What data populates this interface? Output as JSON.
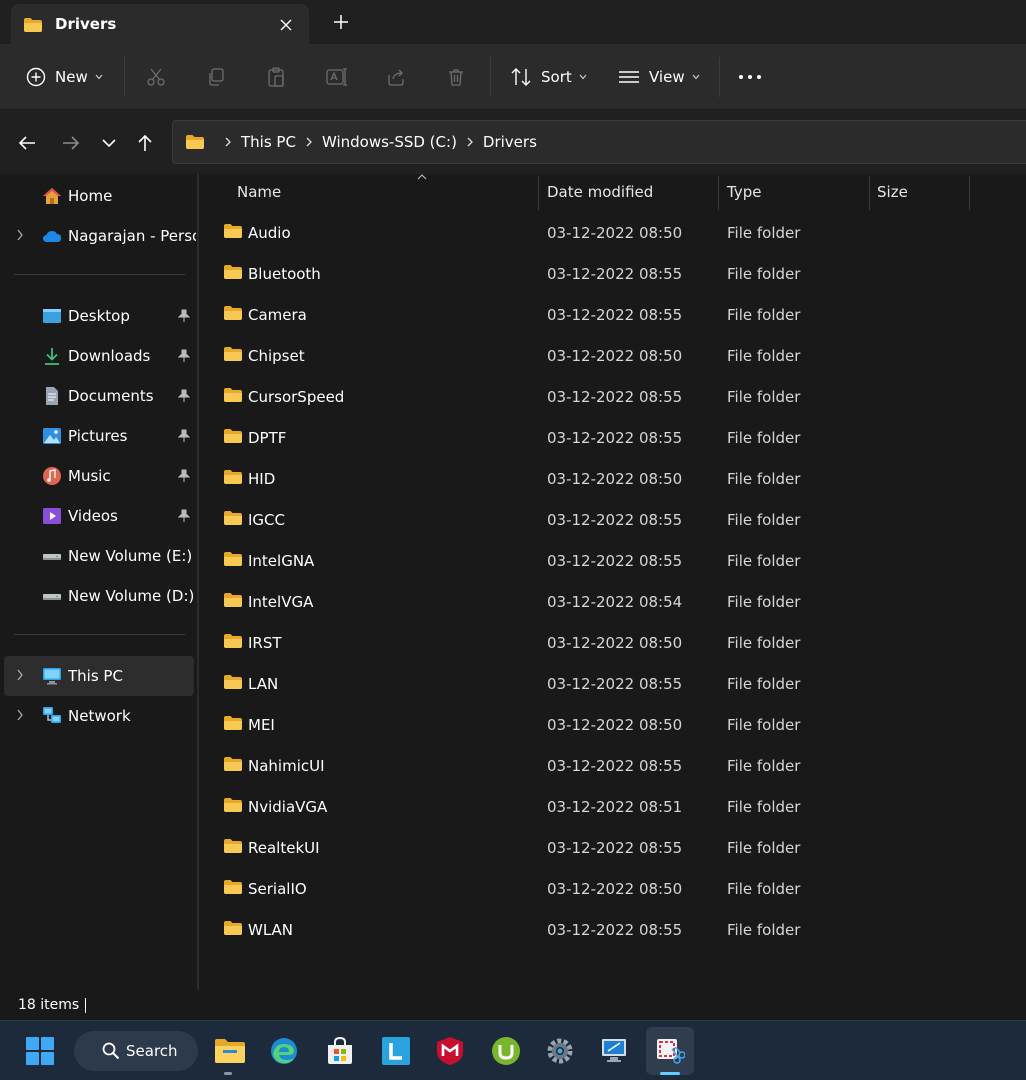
{
  "tab": {
    "title": "Drivers"
  },
  "toolbar": {
    "new_label": "New",
    "sort_label": "Sort",
    "view_label": "View"
  },
  "address": {
    "crumbs": [
      "This PC",
      "Windows-SSD (C:)",
      "Drivers"
    ]
  },
  "sidebar": {
    "top": [
      {
        "label": "Home",
        "icon": "home-icon"
      },
      {
        "label": "Nagarajan - Person",
        "icon": "onedrive-cloud-icon"
      }
    ],
    "quick": [
      {
        "label": "Desktop",
        "icon": "desktop-icon"
      },
      {
        "label": "Downloads",
        "icon": "download-icon"
      },
      {
        "label": "Documents",
        "icon": "document-icon"
      },
      {
        "label": "Pictures",
        "icon": "pictures-icon"
      },
      {
        "label": "Music",
        "icon": "music-icon"
      },
      {
        "label": "Videos",
        "icon": "videos-icon"
      },
      {
        "label": "New Volume (E:)",
        "icon": "drive-icon"
      },
      {
        "label": "New Volume (D:)",
        "icon": "drive-icon"
      }
    ],
    "bottom": [
      {
        "label": "This PC",
        "icon": "pc-icon"
      },
      {
        "label": "Network",
        "icon": "network-icon"
      }
    ]
  },
  "columns": {
    "name": "Name",
    "date": "Date modified",
    "type": "Type",
    "size": "Size"
  },
  "files": [
    {
      "name": "Audio",
      "date": "03-12-2022 08:50",
      "type": "File folder"
    },
    {
      "name": "Bluetooth",
      "date": "03-12-2022 08:55",
      "type": "File folder"
    },
    {
      "name": "Camera",
      "date": "03-12-2022 08:55",
      "type": "File folder"
    },
    {
      "name": "Chipset",
      "date": "03-12-2022 08:50",
      "type": "File folder"
    },
    {
      "name": "CursorSpeed",
      "date": "03-12-2022 08:55",
      "type": "File folder"
    },
    {
      "name": "DPTF",
      "date": "03-12-2022 08:55",
      "type": "File folder"
    },
    {
      "name": "HID",
      "date": "03-12-2022 08:50",
      "type": "File folder"
    },
    {
      "name": "IGCC",
      "date": "03-12-2022 08:55",
      "type": "File folder"
    },
    {
      "name": "IntelGNA",
      "date": "03-12-2022 08:55",
      "type": "File folder"
    },
    {
      "name": "IntelVGA",
      "date": "03-12-2022 08:54",
      "type": "File folder"
    },
    {
      "name": "IRST",
      "date": "03-12-2022 08:50",
      "type": "File folder"
    },
    {
      "name": "LAN",
      "date": "03-12-2022 08:55",
      "type": "File folder"
    },
    {
      "name": "MEI",
      "date": "03-12-2022 08:50",
      "type": "File folder"
    },
    {
      "name": "NahimicUI",
      "date": "03-12-2022 08:55",
      "type": "File folder"
    },
    {
      "name": "NvidiaVGA",
      "date": "03-12-2022 08:51",
      "type": "File folder"
    },
    {
      "name": "RealtekUI",
      "date": "03-12-2022 08:55",
      "type": "File folder"
    },
    {
      "name": "SerialIO",
      "date": "03-12-2022 08:50",
      "type": "File folder"
    },
    {
      "name": "WLAN",
      "date": "03-12-2022 08:55",
      "type": "File folder"
    }
  ],
  "status": {
    "count": "18 items"
  },
  "taskbar": {
    "search_label": "Search",
    "apps": [
      "start-icon",
      "file-explorer-icon",
      "edge-icon",
      "store-icon",
      "l-app-icon",
      "mcafee-icon",
      "utorrent-icon",
      "settings-icon",
      "remote-desktop-icon",
      "snipping-tool-icon"
    ]
  },
  "colors": {
    "accent": "#60cdff",
    "folder": "#f5c14e",
    "background": "#191919",
    "taskbar": "#1c2a3b"
  }
}
